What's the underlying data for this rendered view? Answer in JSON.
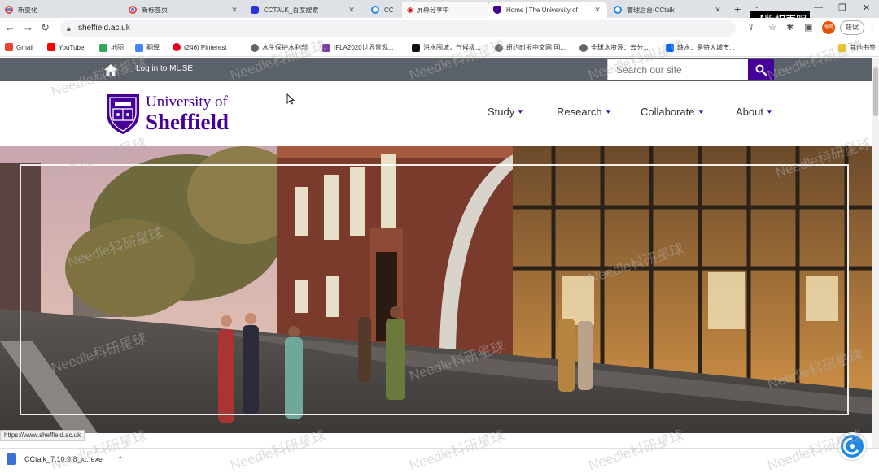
{
  "browser": {
    "tabs": [
      {
        "title": "新变化",
        "icon": "chrome-icon",
        "active": false
      },
      {
        "title": "新标签页",
        "icon": "chrome-icon",
        "active": false
      },
      {
        "title": "CCTALK_百度搜索",
        "icon": "baidu-icon",
        "active": false
      },
      {
        "title": "CC",
        "icon": "cctalk-icon",
        "active": false
      },
      {
        "title": "屏幕分享中",
        "icon": "screen-share-icon",
        "active": false
      },
      {
        "title": "Home | The University of",
        "icon": "sheffield-shield-icon",
        "active": true
      },
      {
        "title": "管理后台-CCtalk",
        "icon": "cctalk-icon",
        "active": false
      }
    ],
    "new_tab_label": "+",
    "notice": "【版权声明",
    "address": "sheffield.ac.uk",
    "profile_label": "薄荷",
    "error_button": "错误",
    "bookmarks": [
      {
        "label": "Gmail",
        "icon": "gmail-icon",
        "color": "#ea4335"
      },
      {
        "label": "YouTube",
        "icon": "youtube-icon",
        "color": "#ff0000"
      },
      {
        "label": "地图",
        "icon": "maps-icon",
        "color": "#34a853"
      },
      {
        "label": "翻译",
        "icon": "translate-icon",
        "color": "#4285f4"
      },
      {
        "label": "(246) Pinterest",
        "icon": "pinterest-icon",
        "color": "#e60023"
      },
      {
        "label": "水生保护水利部",
        "icon": "globe-icon",
        "color": "#666666"
      },
      {
        "label": "IFLA2020世界景观...",
        "icon": "ifla-icon",
        "color": "#7b3fa0"
      },
      {
        "label": "洪水围城，气候极...",
        "icon": "nyt-icon",
        "color": "#111111"
      },
      {
        "label": "纽约时报中文网 国...",
        "icon": "globe-icon",
        "color": "#666666"
      },
      {
        "label": "全球水资源：云分...",
        "icon": "globe-icon",
        "color": "#666666"
      },
      {
        "label": "缺水：是特大城市...",
        "icon": "zhihu-icon",
        "color": "#0066ff"
      },
      {
        "label": "其他书签",
        "icon": "folder-icon",
        "color": "#f5c518"
      }
    ],
    "status_url": "https://www.sheffield.ac.uk",
    "download_file": "CCtalk_7.10.9.8_x...exe"
  },
  "site": {
    "top_bar": {
      "login": "Log in to MUSE",
      "search_placeholder": "Search our site"
    },
    "logo": {
      "line1": "University of",
      "line2": "Sheffield"
    },
    "nav": [
      {
        "label": "Study"
      },
      {
        "label": "Research"
      },
      {
        "label": "Collaborate"
      },
      {
        "label": "About"
      }
    ],
    "colors": {
      "brand_purple": "#440099",
      "topbar_grey": "#5a6168"
    }
  },
  "watermark": "Needle科研星球"
}
